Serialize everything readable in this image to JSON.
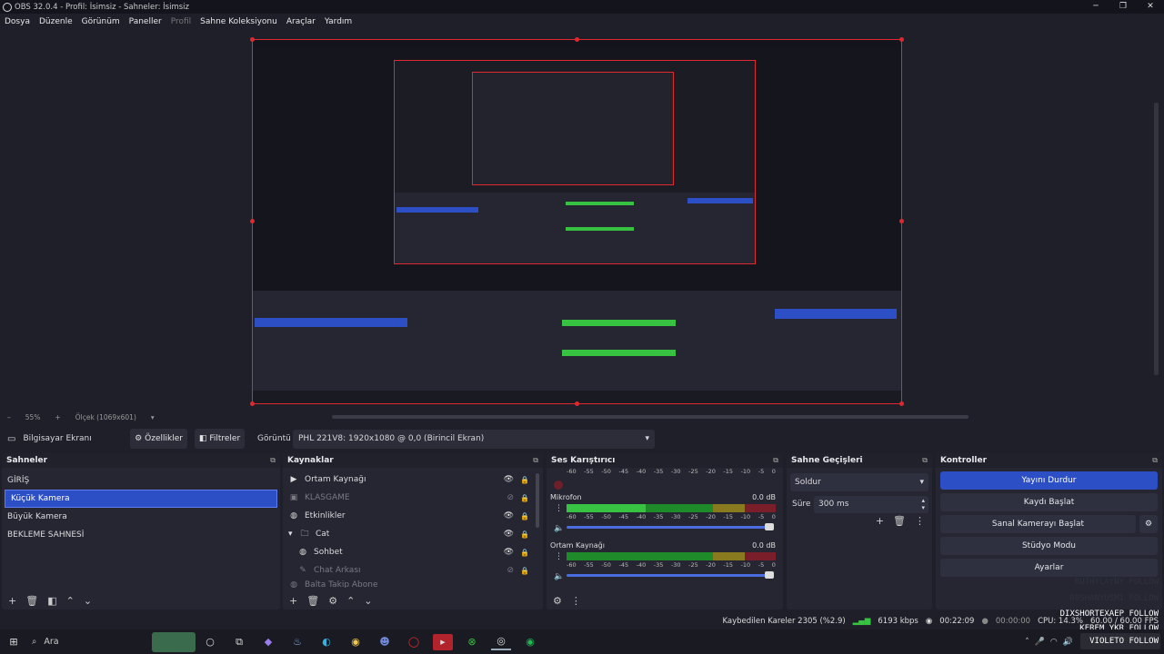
{
  "window": {
    "title": "OBS 32.0.4 - Profil: İsimsiz - Sahneler: İsimsiz",
    "minimize": "─",
    "maximize": "❐",
    "close": "✕"
  },
  "menu": [
    "Dosya",
    "Düzenle",
    "Görünüm",
    "Paneller",
    "Profil",
    "Sahne Koleksiyonu",
    "Araçlar",
    "Yardım"
  ],
  "scale": {
    "zoom": "55%",
    "label": "Ölçek (1069x601)"
  },
  "source_toolbar": {
    "source_name": "Bilgisayar Ekranı",
    "properties": "Özellikler",
    "filters": "Filtreler",
    "display_label": "Görüntü",
    "display_value": "PHL 221V8: 1920x1080 @ 0,0 (Birincil Ekran)"
  },
  "scenes": {
    "title": "Sahneler",
    "items": [
      "GİRİŞ",
      "Küçük Kamera",
      "Büyük Kamera",
      "BEKLEME SAHNESİ"
    ],
    "selected": 1
  },
  "sources": {
    "title": "Kaynaklar",
    "items": [
      {
        "label": "Ortam Kaynağı",
        "icon": "play-icon",
        "dim": false
      },
      {
        "label": "KLASGAME",
        "icon": "image-icon",
        "dim": true
      },
      {
        "label": "Etkinlikler",
        "icon": "globe-icon",
        "dim": false
      },
      {
        "label": "Cat",
        "icon": "folder-icon",
        "dim": false
      },
      {
        "label": "Sohbet",
        "icon": "globe-icon",
        "dim": false
      },
      {
        "label": "Chat Arkası",
        "icon": "brush-icon",
        "dim": true
      },
      {
        "label": "Balta Takip Abone",
        "icon": "globe-icon",
        "dim": true
      }
    ]
  },
  "mixer": {
    "title": "Ses Karıştırıcı",
    "ticks": [
      "-60",
      "-55",
      "-50",
      "-45",
      "-40",
      "-35",
      "-30",
      "-25",
      "-20",
      "-15",
      "-10",
      "-5",
      "0"
    ],
    "channels": [
      {
        "name": "Mikrofon",
        "db": "0.0 dB",
        "level": 0.38
      },
      {
        "name": "Ortam Kaynağı",
        "db": "0.0 dB",
        "level": 0.0
      }
    ]
  },
  "transitions": {
    "title": "Sahne Geçişleri",
    "type": "Soldur",
    "duration_label": "Süre",
    "duration": "300 ms"
  },
  "controls": {
    "title": "Kontroller",
    "buttons": [
      "Yayını Durdur",
      "Kaydı Başlat",
      "Sanal Kamerayı Başlat",
      "Stüdyo Modu",
      "Ayarlar"
    ]
  },
  "status": {
    "dropped": "Kaybedilen Kareler 2305 (%2.9)",
    "bitrate": "6193 kbps",
    "stream_time": "00:22:09",
    "rec_time": "00:00:00",
    "cpu": "CPU: 14.3%",
    "fps": "60.00 / 60.00 FPS"
  },
  "overlay": {
    "lines": [
      "DIXSHORTEXAEP FOLLOW",
      "KEREM_YKR FOLLOW",
      "VIOLETO FOLLOW"
    ],
    "faint": [
      "RUTHYLAYNY FOLLOW",
      "R0SHANYUSMI FOLLOW"
    ]
  },
  "taskbar": {
    "search": "Ara"
  }
}
